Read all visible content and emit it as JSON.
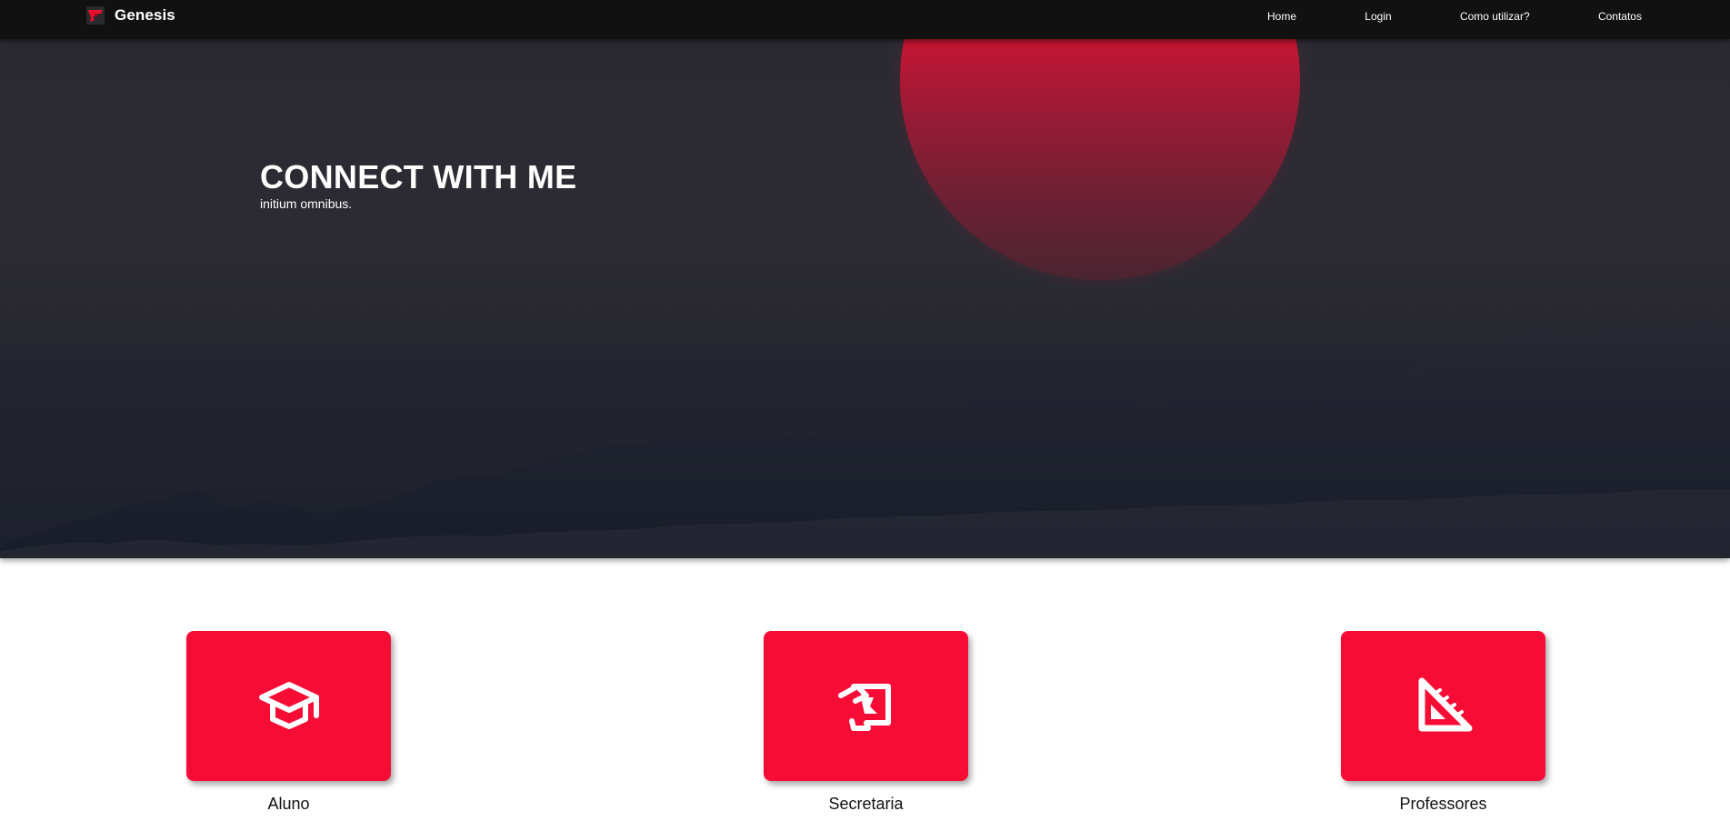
{
  "navbar": {
    "brand_name": "Genesis",
    "brand_logo_icon": "genesis-logo-icon",
    "links": {
      "home": "Home",
      "login": "Login",
      "como_utilizar": "Como utilizar?",
      "contatos": "Contatos"
    }
  },
  "hero": {
    "title": "CONNECT WITH ME",
    "subtitle": "initium omnibus."
  },
  "cards": {
    "aluno": {
      "label": "Aluno",
      "icon": "graduation-cap-icon"
    },
    "secretaria": {
      "label": "Secretaria",
      "icon": "scroll-document-icon"
    },
    "professores": {
      "label": "Professores",
      "icon": "set-square-ruler-icon"
    }
  },
  "colors": {
    "navbar_bg": "#111112",
    "hero_bg": "#2c2b33",
    "accent_red": "#f70c36",
    "sun_red": "#e8102f",
    "white": "#ffffff"
  }
}
